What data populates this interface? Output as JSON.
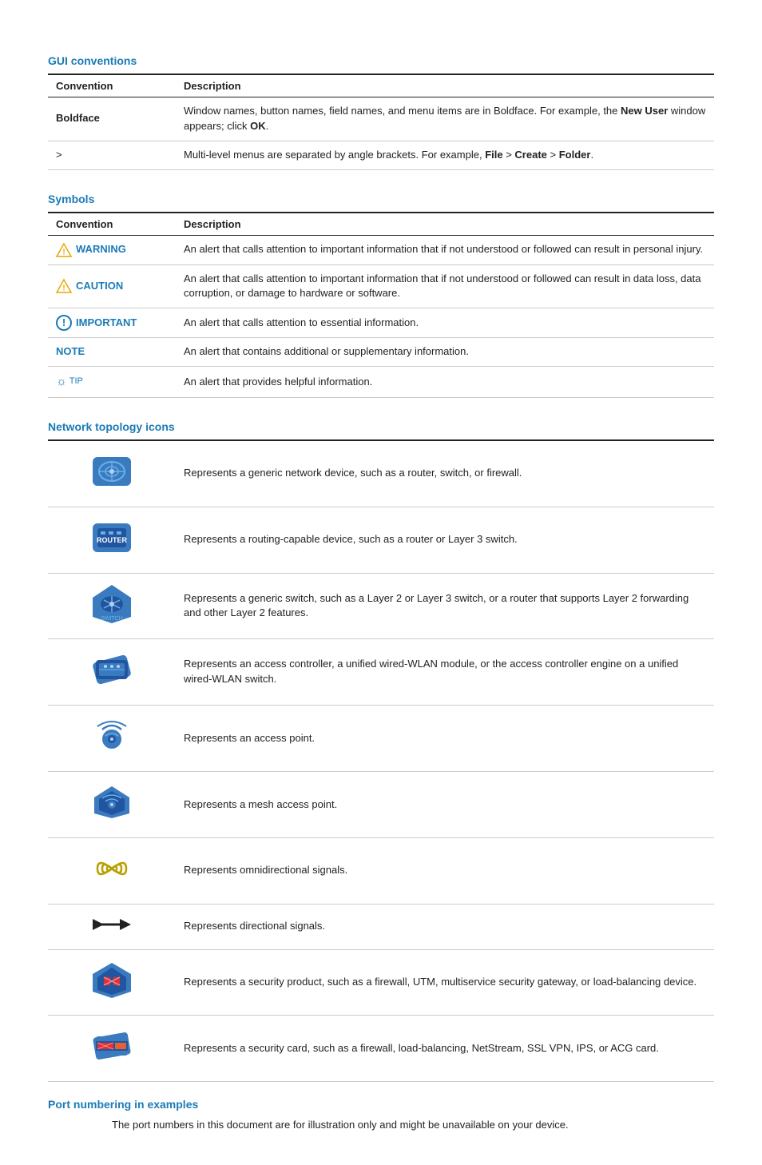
{
  "sections": {
    "gui_conventions": {
      "title": "GUI conventions",
      "columns": [
        "Convention",
        "Description"
      ],
      "rows": [
        {
          "convention": "Boldface",
          "bold": true,
          "description": "Window names, button names, field names, and menu items are in Boldface. For example, the ",
          "description_bold": "New User",
          "description_mid": " window appears; click ",
          "description_bold2": "OK",
          "description_end": ".",
          "type": "boldface"
        },
        {
          "convention": ">",
          "bold": false,
          "description_html": "Multi-level menus are separated by angle brackets. For example, <b>File</b> &gt; <b>Create</b> &gt; <b>Folder</b>.",
          "type": "angle"
        }
      ]
    },
    "symbols": {
      "title": "Symbols",
      "columns": [
        "Convention",
        "Description"
      ],
      "rows": [
        {
          "type": "warning",
          "label": "WARNING",
          "description": "An alert that calls attention to important information that if not understood or followed can result in personal injury."
        },
        {
          "type": "caution",
          "label": "CAUTION",
          "description": "An alert that calls attention to important information that if not understood or followed can result in data loss, data corruption, or damage to hardware or software."
        },
        {
          "type": "important",
          "label": "IMPORTANT",
          "description": "An alert that calls attention to essential information."
        },
        {
          "type": "note",
          "label": "NOTE",
          "description": "An alert that contains additional or supplementary information."
        },
        {
          "type": "tip",
          "label": "TIP",
          "description": "An alert that provides helpful information."
        }
      ]
    },
    "network_topology": {
      "title": "Network topology icons",
      "rows": [
        {
          "icon_type": "generic_device",
          "description": "Represents a generic network device, such as a router, switch, or firewall."
        },
        {
          "icon_type": "router",
          "description": "Represents a routing-capable device, such as a router or Layer 3 switch."
        },
        {
          "icon_type": "switch",
          "description": "Represents a generic switch, such as a Layer 2 or Layer 3 switch, or a router that supports Layer 2 forwarding and other Layer 2 features."
        },
        {
          "icon_type": "access_controller",
          "description": "Represents an access controller, a unified wired-WLAN module, or the access controller engine on a unified wired-WLAN switch."
        },
        {
          "icon_type": "access_point",
          "description": "Represents an access point."
        },
        {
          "icon_type": "mesh_access_point",
          "description": "Represents a mesh access point."
        },
        {
          "icon_type": "omni_signal",
          "description": "Represents omnidirectional signals."
        },
        {
          "icon_type": "directional_signal",
          "description": "Represents directional signals."
        },
        {
          "icon_type": "security_product",
          "description": "Represents a security product, such as a firewall, UTM, multiservice security gateway, or load-balancing device."
        },
        {
          "icon_type": "security_card",
          "description": "Represents a security card, such as a firewall, load-balancing, NetStream, SSL VPN, IPS, or ACG card."
        }
      ]
    },
    "port_numbering": {
      "title": "Port numbering in examples",
      "description": "The port numbers in this document are for illustration only and might be unavailable on your device."
    }
  }
}
